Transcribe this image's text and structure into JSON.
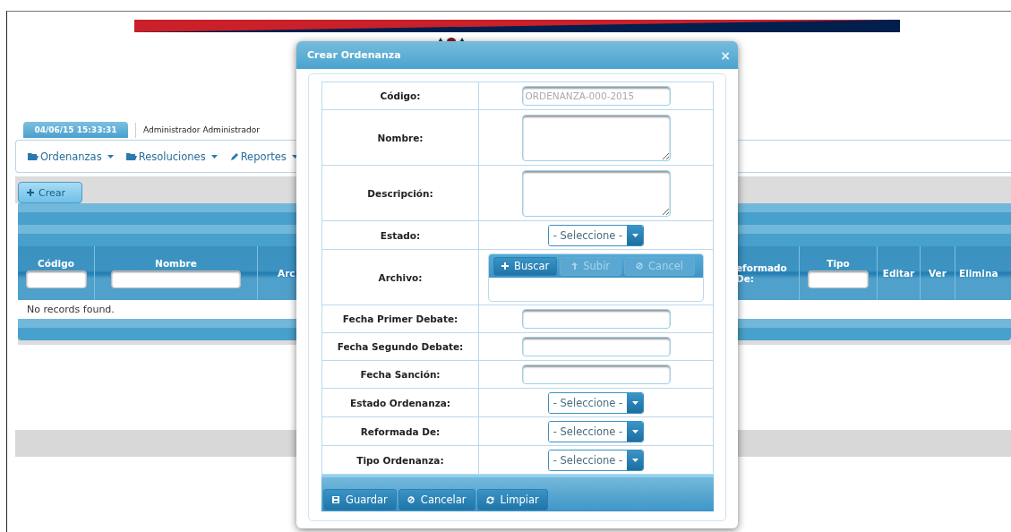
{
  "session": {
    "datetime": "04/06/15 15:33:31",
    "user": "Administrador Administrador"
  },
  "menu": [
    {
      "label": "Ordenanzas"
    },
    {
      "label": "Resoluciones"
    },
    {
      "label": "Reportes"
    }
  ],
  "toolbar": {
    "create_button": "Crear"
  },
  "grid": {
    "columns": [
      {
        "label": "Código",
        "filter": true
      },
      {
        "label": "Nombre",
        "filter": true
      },
      {
        "label": "Arc",
        "filter": false
      },
      {
        "label": "eformado De:",
        "filter": false
      },
      {
        "label": "Tipo",
        "filter": true
      },
      {
        "label": "Editar",
        "filter": false
      },
      {
        "label": "Ver",
        "filter": false
      },
      {
        "label": "Elimina",
        "filter": false
      }
    ],
    "empty_message": "No records found."
  },
  "dialog": {
    "title": "Crear Ordenanza",
    "close": "×",
    "fields": [
      {
        "label": "Código:",
        "kind": "text",
        "placeholder": "ORDENANZA-000-2015"
      },
      {
        "label": "Nombre:",
        "kind": "textarea"
      },
      {
        "label": "Descripción:",
        "kind": "textarea"
      },
      {
        "label": "Estado:",
        "kind": "select",
        "value": "- Seleccione -"
      },
      {
        "label": "Archivo:",
        "kind": "upload",
        "buttons": [
          {
            "label": "Buscar",
            "disabled": false
          },
          {
            "label": "Subir",
            "disabled": true
          },
          {
            "label": "Cancel",
            "disabled": true
          }
        ]
      },
      {
        "label": "Fecha Primer Debate:",
        "kind": "text"
      },
      {
        "label": "Fecha Segundo Debate:",
        "kind": "text"
      },
      {
        "label": "Fecha Sanción:",
        "kind": "text"
      },
      {
        "label": "Estado Ordenanza:",
        "kind": "select",
        "value": "- Seleccione -"
      },
      {
        "label": "Reformada De:",
        "kind": "select",
        "value": "- Seleccione -"
      },
      {
        "label": "Tipo Ordenanza:",
        "kind": "select",
        "value": "- Seleccione -"
      }
    ],
    "buttons": [
      {
        "label": "Guardar"
      },
      {
        "label": "Cancelar"
      },
      {
        "label": "Limpiar"
      }
    ]
  }
}
